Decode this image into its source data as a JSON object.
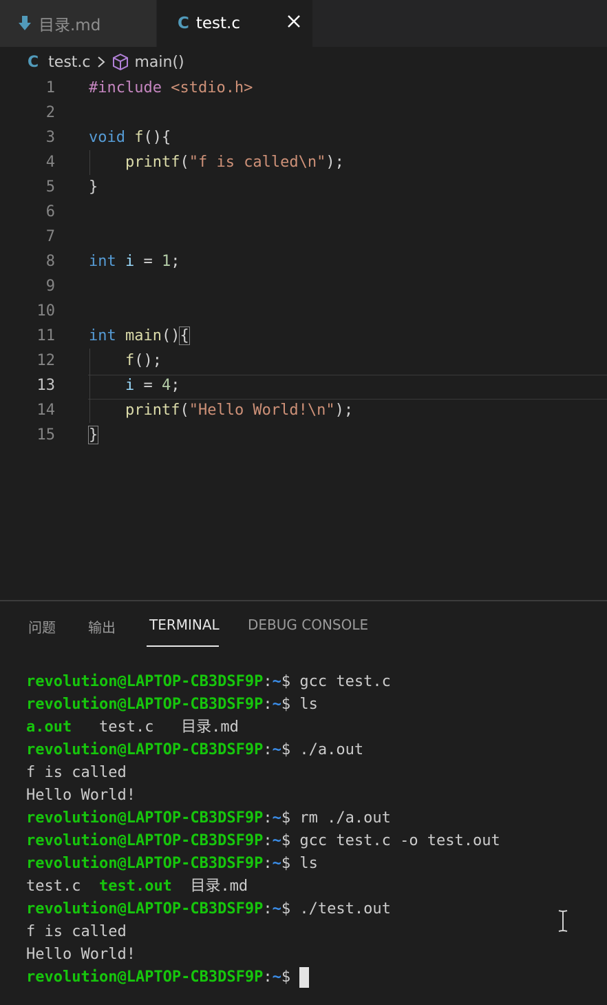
{
  "tabs": [
    {
      "label": "目录.md",
      "icon": "markdown-arrow-icon",
      "active": false
    },
    {
      "label": "test.c",
      "icon": "c-language-icon",
      "active": true
    }
  ],
  "breadcrumb": {
    "file": "test.c",
    "symbol": "main()",
    "c_glyph": "C"
  },
  "editor": {
    "current_line": 13,
    "line_numbers": [
      "1",
      "2",
      "3",
      "4",
      "5",
      "6",
      "7",
      "8",
      "9",
      "10",
      "11",
      "12",
      "13",
      "14",
      "15"
    ],
    "code": {
      "l1": {
        "directive": "#include",
        "header": "<stdio.h>"
      },
      "l3": {
        "type": "void",
        "name": "f",
        "rest": "(){"
      },
      "l4": {
        "fn": "printf",
        "open": "(",
        "str": "\"f is called\\n\"",
        "close": ");"
      },
      "l5": {
        "text": "}"
      },
      "l8": {
        "type": "int",
        "var": "i",
        "eq": " = ",
        "num": "1",
        "end": ";"
      },
      "l11": {
        "type": "int",
        "name": "main",
        "rest": "()",
        "brace": "{"
      },
      "l12": {
        "fn": "f",
        "rest": "();"
      },
      "l13": {
        "var": "i",
        "eq": " = ",
        "num": "4",
        "end": ";"
      },
      "l14": {
        "fn": "printf",
        "open": "(",
        "str": "\"Hello World!\\n\"",
        "close": ");"
      },
      "l15": {
        "brace": "}"
      }
    }
  },
  "panel": {
    "tabs": [
      {
        "label": "问题",
        "active": false
      },
      {
        "label": "输出",
        "active": false
      },
      {
        "label": "TERMINAL",
        "active": true
      },
      {
        "label": "DEBUG CONSOLE",
        "active": false
      }
    ]
  },
  "terminal": {
    "prompt_user": "revolution@LAPTOP-CB3DSF9P",
    "prompt_path": "~",
    "prompt_sep": ":",
    "prompt_end": "$ ",
    "lines": {
      "c1": "gcc test.c",
      "c2": "ls",
      "ls1_exe": "a.out",
      "ls1_rest": "   test.c   目录.md",
      "c3": "./a.out",
      "o1": "f is called",
      "o2": "Hello World!",
      "c4": "rm ./a.out",
      "c5": "gcc test.c -o test.out",
      "c6": "ls",
      "ls2_a": "test.c  ",
      "ls2_exe": "test.out",
      "ls2_b": "  目录.md",
      "c7": "./test.out",
      "o3": "f is called",
      "o4": "Hello World!"
    }
  },
  "colors": {
    "background": "#1e1e1e",
    "prompt_green": "#16c60c",
    "prompt_blue": "#3b8eea",
    "keyword": "#569cd6",
    "string": "#ce9178"
  }
}
